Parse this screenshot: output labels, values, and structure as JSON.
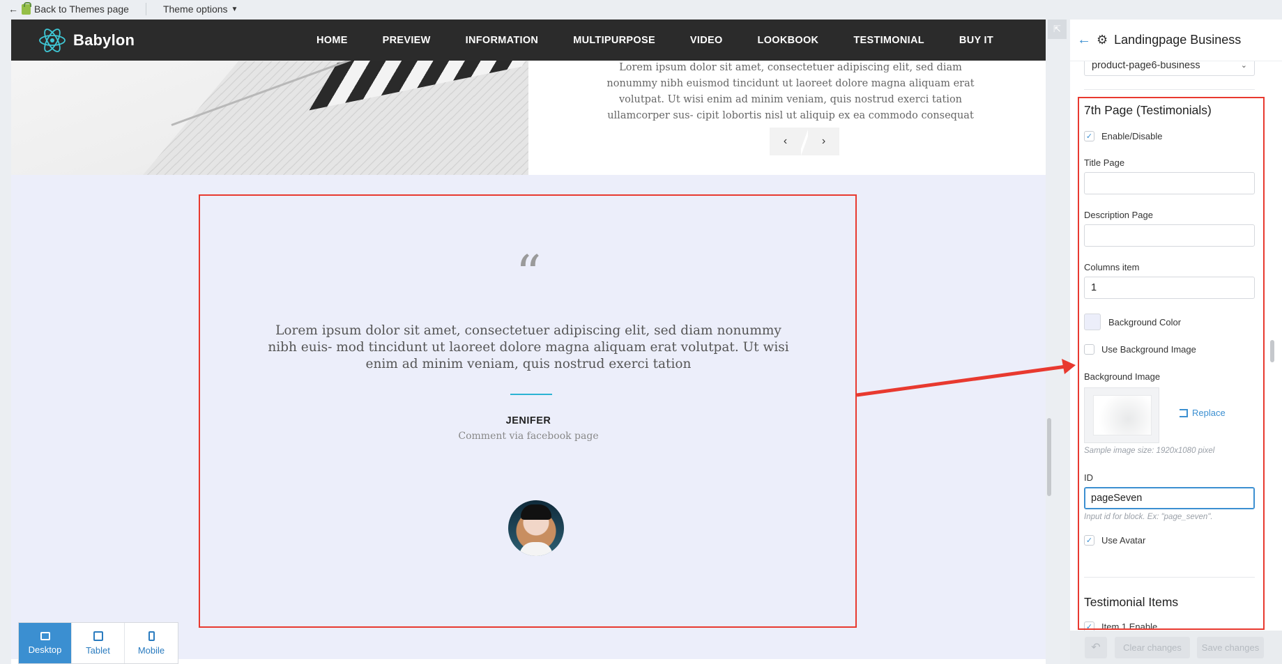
{
  "topbar": {
    "back_label": "Back to Themes page",
    "theme_options_label": "Theme options"
  },
  "site": {
    "brand": "Babylon",
    "nav": [
      "HOME",
      "PREVIEW",
      "INFORMATION",
      "MULTIPURPOSE",
      "VIDEO",
      "LOOKBOOK",
      "TESTIMONIAL",
      "BUY IT"
    ],
    "hero_text": "Lorem ipsum dolor sit amet, consectetuer adipiscing elit, sed diam nonummy nibh euismod tincidunt ut laoreet dolore magna aliquam erat volutpat. Ut wisi enim ad minim veniam, quis nostrud exerci tation ullamcorper sus- cipit lobortis nisl ut aliquip ex ea commodo consequat",
    "prev_label": "‹",
    "next_label": "›",
    "testimonial": {
      "quote_mark": "“",
      "text": "Lorem ipsum dolor sit amet, consectetuer adipiscing elit, sed diam nonummy nibh euis- mod tincidunt ut laoreet dolore magna aliquam erat volutpat. Ut wisi enim ad minim veniam, quis nostrud exerci tation",
      "author": "JENIFER",
      "via": "Comment via facebook page"
    }
  },
  "devices": [
    {
      "label": "Desktop",
      "active": true
    },
    {
      "label": "Tablet",
      "active": false
    },
    {
      "label": "Mobile",
      "active": false
    }
  ],
  "sidebar": {
    "title": "Landingpage Business",
    "select_value": "product-page6-business",
    "section_title": "7th Page (Testimonials)",
    "enable_label": "Enable/Disable",
    "title_page_label": "Title Page",
    "title_page_value": "",
    "description_page_label": "Description Page",
    "description_page_value": "",
    "columns_label": "Columns item",
    "columns_value": "1",
    "bg_color_label": "Background Color",
    "bg_color_value": "#eceefa",
    "use_bg_image_label": "Use Background Image",
    "bg_image_label": "Background Image",
    "replace_label": "Replace",
    "sample_hint": "Sample image size: 1920x1080 pixel",
    "id_label": "ID",
    "id_value": "pageSeven",
    "id_hint": "Input id for block. Ex: \"page_seven\".",
    "use_avatar_label": "Use Avatar",
    "items_title": "Testimonial Items",
    "item1_label": "Item 1 Enable"
  },
  "footer": {
    "clear_label": "Clear changes",
    "save_label": "Save changes"
  },
  "colors": {
    "accent": "#3b8fd1",
    "annotation": "#e8392f",
    "divider": "#2bb3d3"
  }
}
